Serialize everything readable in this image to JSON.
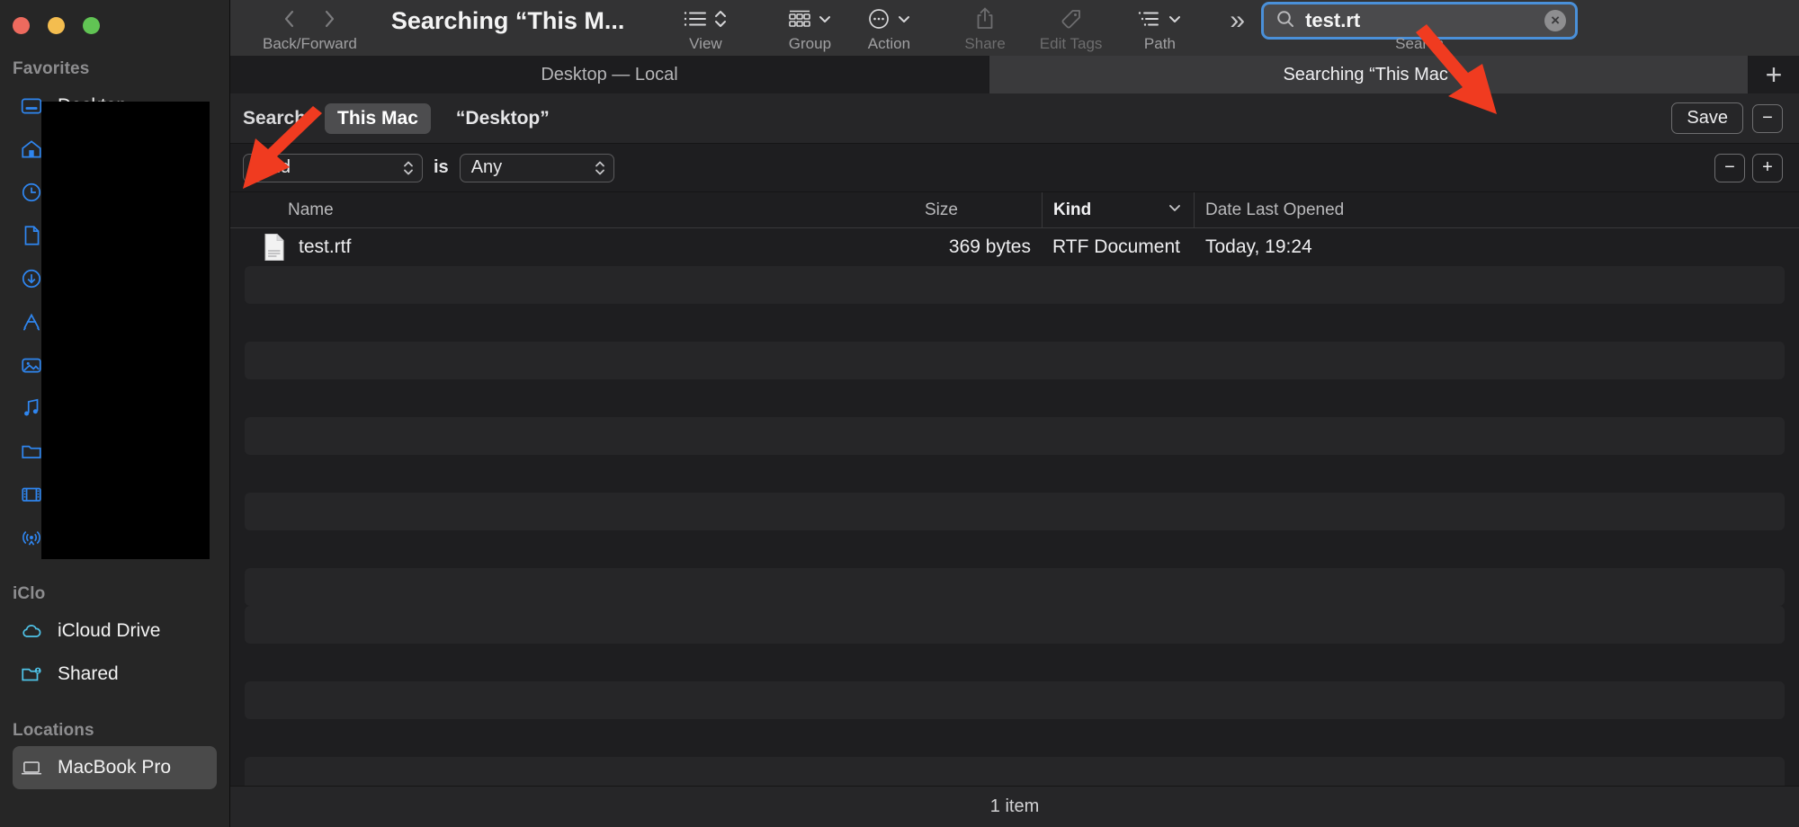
{
  "window": {
    "title": "Searching “This M...",
    "traffic_lights": [
      "close",
      "minimize",
      "zoom"
    ]
  },
  "toolbar": {
    "back_forward_label": "Back/Forward",
    "view_label": "View",
    "group_label": "Group",
    "action_label": "Action",
    "share_label": "Share",
    "edit_tags_label": "Edit Tags",
    "path_label": "Path",
    "overflow_label": "»",
    "search_label": "Search"
  },
  "search": {
    "value": "test.rt",
    "placeholder": "Search",
    "icon": "search-icon",
    "clear_icon": "×",
    "focused_border_color": "#4a90d9"
  },
  "tabs": [
    {
      "label": "Desktop — Local",
      "active": false
    },
    {
      "label": "Searching “This Mac”",
      "active": true
    }
  ],
  "tab_add_label": "+",
  "scope": {
    "label": "Search:",
    "options": [
      {
        "label": "This Mac",
        "selected": true
      },
      {
        "label": "“Desktop”",
        "selected": false
      }
    ],
    "save_label": "Save",
    "remove_label": "−"
  },
  "filter": {
    "attribute": "Kind",
    "operator": "is",
    "value": "Any",
    "remove_label": "−",
    "add_label": "+"
  },
  "columns": [
    {
      "label": "Name",
      "sorted": false
    },
    {
      "label": "Size",
      "sorted": false
    },
    {
      "label": "Kind",
      "sorted": true
    },
    {
      "label": "Date Last Opened",
      "sorted": false
    }
  ],
  "rows": [
    {
      "name": "test.rtf",
      "size": "369 bytes",
      "kind": "RTF Document",
      "date": "Today, 19:24",
      "icon": "rtf-document-icon"
    }
  ],
  "status": {
    "item_count": "1 item"
  },
  "sidebar": {
    "sections": [
      {
        "title": "Favorites",
        "items": [
          {
            "label": "Desktop",
            "icon": "desktop-icon",
            "selected": false
          },
          {
            "label": "Home",
            "icon": "home-icon",
            "selected": false
          },
          {
            "label": "Recents",
            "icon": "clock-icon",
            "selected": false
          },
          {
            "label": "Documents",
            "icon": "document-icon",
            "selected": false
          },
          {
            "label": "Downloads",
            "icon": "download-icon",
            "selected": false
          },
          {
            "label": "Applications",
            "icon": "applications-icon",
            "selected": false
          },
          {
            "label": "Pictures",
            "icon": "pictures-icon",
            "selected": false
          },
          {
            "label": "Music",
            "icon": "music-icon",
            "selected": false
          },
          {
            "label": "Folder",
            "icon": "folder-icon",
            "selected": false
          },
          {
            "label": "Movies",
            "icon": "movies-icon",
            "selected": false
          },
          {
            "label": "AirDrop",
            "icon": "airdrop-icon",
            "selected": false
          }
        ]
      },
      {
        "title": "iClo",
        "items": [
          {
            "label": "iCloud Drive",
            "icon": "icloud-icon",
            "selected": false
          },
          {
            "label": "Shared",
            "icon": "shared-folder-icon",
            "selected": false
          }
        ]
      },
      {
        "title": "Locations",
        "items": [
          {
            "label": "MacBook Pro",
            "icon": "laptop-icon",
            "selected": true
          }
        ]
      }
    ]
  },
  "annotations": {
    "arrow_color": "#f03b20",
    "arrows": [
      {
        "name": "arrow-to-search-field"
      },
      {
        "name": "arrow-to-this-mac-button"
      }
    ]
  }
}
